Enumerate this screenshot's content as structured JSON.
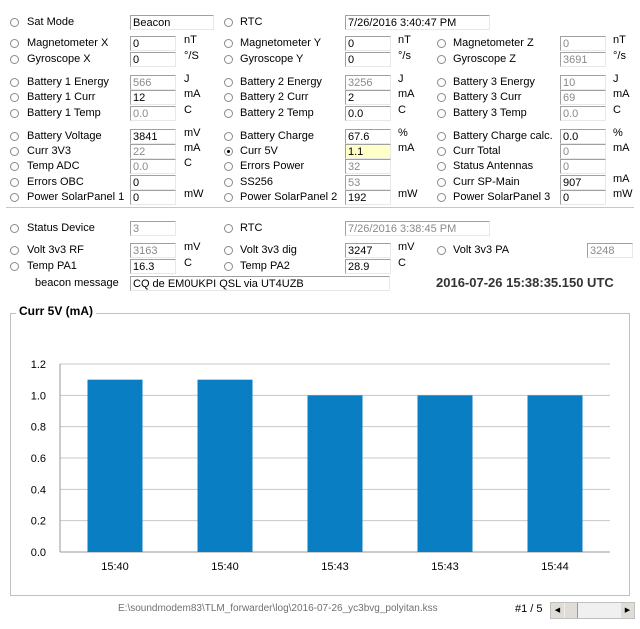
{
  "fields": [
    {
      "label": "Sat Mode",
      "value": "Beacon",
      "col": 0,
      "row": 16,
      "wide": true
    },
    {
      "label": "RTC",
      "value": "7/26/2016 3:40:47 PM",
      "col": 1,
      "row": 16,
      "wide": true,
      "rwide": true
    },
    {
      "label": "Magnetometer X",
      "value": "0",
      "unit": "nT",
      "col": 0,
      "row": 37
    },
    {
      "label": "Magnetometer Y",
      "value": "0",
      "unit": "nT",
      "col": 1,
      "row": 37
    },
    {
      "label": "Magnetometer Z",
      "value": "0",
      "unit": "nT",
      "col": 2,
      "row": 37,
      "dis": true
    },
    {
      "label": "Gyroscope X",
      "value": "0",
      "unit": "°/S",
      "col": 0,
      "row": 53
    },
    {
      "label": "Gyroscope Y",
      "value": "0",
      "unit": "°/s",
      "col": 1,
      "row": 53
    },
    {
      "label": "Gyroscope Z",
      "value": "3691",
      "unit": "°/s",
      "col": 2,
      "row": 53,
      "dis": true
    },
    {
      "label": "Battery 1 Energy",
      "value": "566",
      "unit": "J",
      "col": 0,
      "row": 76,
      "dis": true
    },
    {
      "label": "Battery 2 Energy",
      "value": "3256",
      "unit": "J",
      "col": 1,
      "row": 76,
      "dis": true
    },
    {
      "label": "Battery 3 Energy",
      "value": "10",
      "unit": "J",
      "col": 2,
      "row": 76,
      "dis": true
    },
    {
      "label": "Battery 1 Curr",
      "value": "12",
      "unit": "mA",
      "col": 0,
      "row": 91
    },
    {
      "label": "Battery 2 Curr",
      "value": "2",
      "unit": "mA",
      "col": 1,
      "row": 91
    },
    {
      "label": "Battery 3 Curr",
      "value": "69",
      "unit": "mA",
      "col": 2,
      "row": 91,
      "dis": true
    },
    {
      "label": "Battery 1 Temp",
      "value": "0.0",
      "unit": "C",
      "col": 0,
      "row": 107,
      "dis": true
    },
    {
      "label": "Battery 2 Temp",
      "value": "0.0",
      "unit": "C",
      "col": 1,
      "row": 107
    },
    {
      "label": "Battery 3 Temp",
      "value": "0.0",
      "unit": "C",
      "col": 2,
      "row": 107,
      "dis": true
    },
    {
      "label": "Battery Voltage",
      "value": "3841",
      "unit": "mV",
      "col": 0,
      "row": 130
    },
    {
      "label": "Battery Charge",
      "value": "67.6",
      "unit": "%",
      "col": 1,
      "row": 130
    },
    {
      "label": "Battery Charge calc.",
      "value": "0.0",
      "unit": "%",
      "col": 2,
      "row": 130
    },
    {
      "label": "Curr 3V3",
      "value": "22",
      "unit": "mA",
      "col": 0,
      "row": 145,
      "dis": true
    },
    {
      "label": "Curr 5V",
      "value": "1.1",
      "unit": "mA",
      "col": 1,
      "row": 145,
      "checked": true,
      "hl": true
    },
    {
      "label": "Curr Total",
      "value": "0",
      "unit": "mA",
      "col": 2,
      "row": 145,
      "dis": true
    },
    {
      "label": "Temp ADC",
      "value": "0.0",
      "unit": "C",
      "col": 0,
      "row": 160,
      "dis": true
    },
    {
      "label": "Errors Power",
      "value": "32",
      "col": 1,
      "row": 160,
      "dis": true
    },
    {
      "label": "Status Antennas",
      "value": "0",
      "col": 2,
      "row": 160,
      "dis": true
    },
    {
      "label": "Errors OBC",
      "value": "0",
      "col": 0,
      "row": 176
    },
    {
      "label": "SS256",
      "value": "53",
      "col": 1,
      "row": 176,
      "dis": true
    },
    {
      "label": "Curr SP-Main",
      "value": "907",
      "unit": "mA",
      "col": 2,
      "row": 176
    },
    {
      "label": "Power SolarPanel 1",
      "value": "0",
      "unit": "mW",
      "col": 0,
      "row": 191
    },
    {
      "label": "Power SolarPanel 2",
      "value": "192",
      "unit": "mW",
      "col": 1,
      "row": 191
    },
    {
      "label": "Power SolarPanel 3",
      "value": "0",
      "unit": "mW",
      "col": 2,
      "row": 191
    },
    {
      "label": "Status Device",
      "value": "3",
      "col": 0,
      "row": 222,
      "dis": true
    },
    {
      "label": "RTC",
      "value": "7/26/2016 3:38:45 PM",
      "col": 1,
      "row": 222,
      "rwide": true,
      "dis": true
    },
    {
      "label": "Volt 3v3 RF",
      "value": "3163",
      "unit": "mV",
      "col": 0,
      "row": 244,
      "dis": true
    },
    {
      "label": "Volt 3v3 dig",
      "value": "3247",
      "unit": "mV",
      "col": 1,
      "row": 244
    },
    {
      "label": "Volt 3v3 PA",
      "value": "3248",
      "unit": "mV",
      "col": 2,
      "row": 244,
      "dis": true,
      "shift": true
    },
    {
      "label": "Temp PA1",
      "value": "16.3",
      "unit": "C",
      "col": 0,
      "row": 260
    },
    {
      "label": "Temp PA2",
      "value": "28.9",
      "unit": "C",
      "col": 1,
      "row": 260
    }
  ],
  "beacon": {
    "label": "beacon message",
    "value": "CQ de EM0UKPI QSL via UT4UZB"
  },
  "timestamp": "2016-07-26 15:38:35.150 UTC",
  "footer": {
    "path": "E:\\soundmodem83\\TLM_forwarder\\log\\2016-07-26_yc3bvg_polyitan.kss",
    "page": "#1 / 5"
  },
  "colors": {
    "bar": "#0a7ec2"
  },
  "chart_data": {
    "type": "bar",
    "title": "Curr 5V (mA)",
    "categories": [
      "15:40",
      "15:40",
      "15:43",
      "15:43",
      "15:44"
    ],
    "values": [
      1.1,
      1.1,
      1.0,
      1.0,
      1.0
    ],
    "ylim": [
      0,
      1.2
    ],
    "yticks": [
      "0.0",
      "0.2",
      "0.4",
      "0.6",
      "0.8",
      "1.0",
      "1.2"
    ],
    "grid": true
  }
}
